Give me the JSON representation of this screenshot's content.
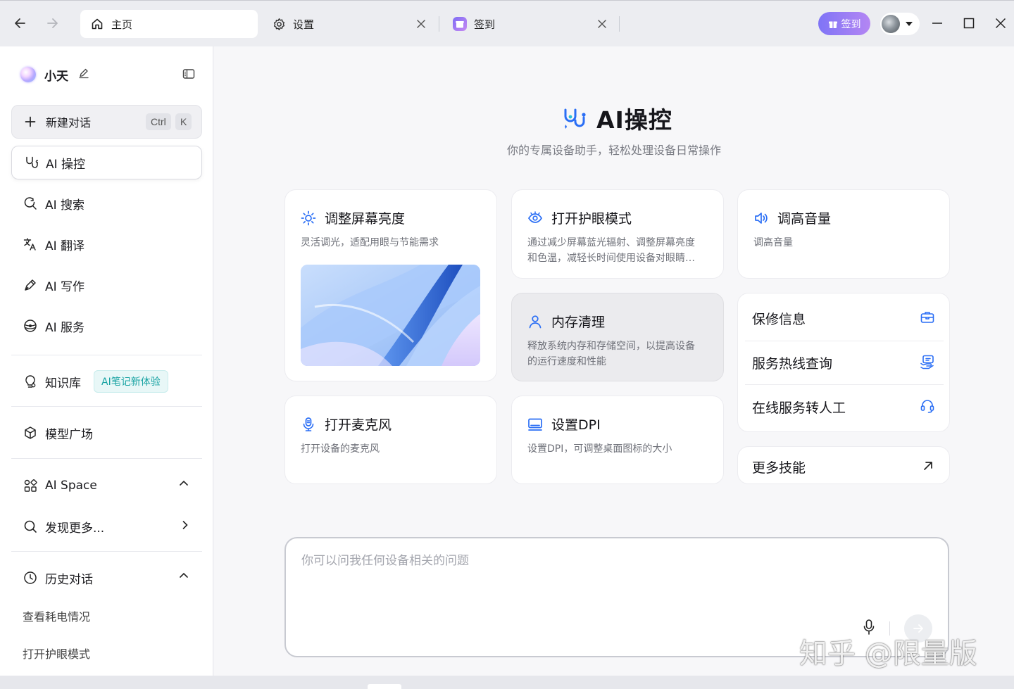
{
  "window": {
    "tabs": [
      {
        "label": "主页",
        "icon": "home-icon",
        "active": true
      },
      {
        "label": "设置",
        "icon": "gear-icon",
        "active": false
      },
      {
        "label": "签到",
        "icon": "gift-icon",
        "active": false
      }
    ],
    "checkin_label": "签到",
    "accent": "#8f7cf7"
  },
  "sidebar": {
    "brand_name": "小天",
    "new_chat": {
      "label": "新建对话",
      "shortcut_ctrl": "Ctrl",
      "shortcut_key": "K"
    },
    "items": [
      {
        "label": "AI 操控",
        "icon": "stethoscope-icon",
        "active": true
      },
      {
        "label": "AI 搜索",
        "icon": "search-refresh-icon"
      },
      {
        "label": "AI 翻译",
        "icon": "translate-icon"
      },
      {
        "label": "AI 写作",
        "icon": "pen-icon"
      },
      {
        "label": "AI 服务",
        "icon": "service-ring-icon"
      }
    ],
    "knowledge": {
      "label": "知识库",
      "badge": "AI笔记新体验"
    },
    "model_plaza": "模型广场",
    "ai_space": "AI Space",
    "discover": "发现更多...",
    "history_title": "历史对话",
    "history_items": [
      "查看耗电情况",
      "打开护眼模式"
    ]
  },
  "main": {
    "title": "AI操控",
    "subtitle": "你的专属设备助手，轻松处理设备日常操作",
    "cards": {
      "brightness": {
        "title": "调整屏幕亮度",
        "desc": "灵活调光，适配用眼与节能需求",
        "icon": "sun-icon"
      },
      "eye_care": {
        "title": "打开护眼模式",
        "desc": "通过减少屏幕蓝光辐射、调整屏幕亮度和色温，减轻长时间使用设备对眼睛的伤害",
        "icon": "eye-icon"
      },
      "volume": {
        "title": "调高音量",
        "desc": "调高音量",
        "icon": "speaker-icon"
      },
      "memory": {
        "title": "内存清理",
        "desc": "释放系统内存和存储空间，以提高设备的运行速度和性能",
        "icon": "person-icon"
      },
      "microphone": {
        "title": "打开麦克风",
        "desc": "打开设备的麦克风",
        "icon": "microphone-icon"
      },
      "dpi": {
        "title": "设置DPI",
        "desc": "设置DPI，可调整桌面图标的大小",
        "icon": "monitor-icon"
      }
    },
    "services": [
      {
        "label": "保修信息",
        "icon": "toolbox-icon"
      },
      {
        "label": "服务热线查询",
        "icon": "hotline-icon"
      },
      {
        "label": "在线服务转人工",
        "icon": "headset-icon"
      }
    ],
    "more_skills": "更多技能",
    "ask_placeholder": "你可以问我任何设备相关的问题"
  },
  "watermark": "知乎 @限量版"
}
